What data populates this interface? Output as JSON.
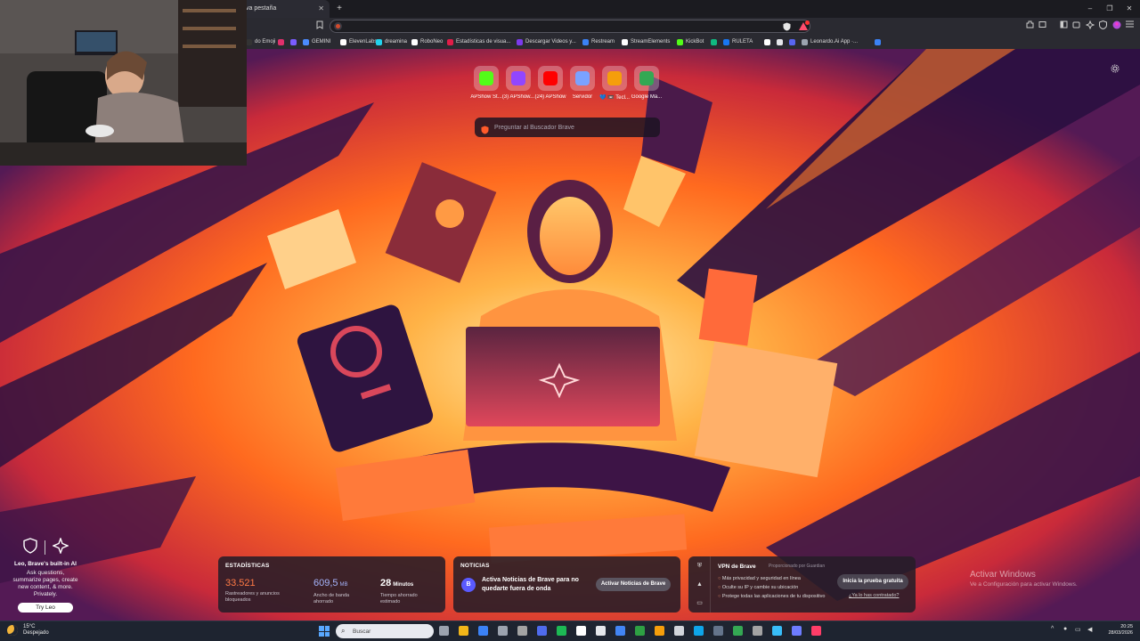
{
  "tab": {
    "title": "va pestaña",
    "close": "✕",
    "new": "+"
  },
  "window": {
    "minimize": "–",
    "maximize": "❐",
    "close": "✕"
  },
  "address": {
    "value": "",
    "placeholder": ""
  },
  "bookmarks": [
    {
      "label": "do Emoji",
      "color": "#333"
    },
    {
      "label": "",
      "color": "#e1306c"
    },
    {
      "label": "",
      "color": "#7b5cff"
    },
    {
      "label": "GEMINI",
      "color": "#4b8bff"
    },
    {
      "label": "ElevenLabs",
      "color": "#ffffff"
    },
    {
      "label": "dreamina",
      "color": "#22d3ee"
    },
    {
      "label": "RoboNeo",
      "color": "#ffffff"
    },
    {
      "label": "Estadísticas de visua...",
      "color": "#e11d48"
    },
    {
      "label": "Descargar Videos y...",
      "color": "#7c3aed"
    },
    {
      "label": "Restream",
      "color": "#3b82f6"
    },
    {
      "label": "StreamElements",
      "color": "#ffffff"
    },
    {
      "label": "KickBot",
      "color": "#53fc18"
    },
    {
      "label": "",
      "color": "#10b981"
    },
    {
      "label": "RULETA",
      "color": "#1877f2"
    },
    {
      "label": "",
      "color": "#ffffff"
    },
    {
      "label": "",
      "color": "#e5e7eb"
    },
    {
      "label": "",
      "color": "#5865f2"
    },
    {
      "label": "Leonardo.Ai App ·...",
      "color": "#9ca3af"
    },
    {
      "label": "",
      "color": "#3b82f6"
    }
  ],
  "top_sites": [
    {
      "label": "APShow St...",
      "icon": "kick-icon",
      "color": "#53fc18"
    },
    {
      "label": "(3) APShow...",
      "icon": "twitch-icon",
      "color": "#9146ff"
    },
    {
      "label": "(24) APShow",
      "icon": "youtube-icon",
      "color": "#ff0000"
    },
    {
      "label": "Servidor",
      "icon": "server-icon",
      "color": "#7aa2ff"
    },
    {
      "label": "💙 📼 Tecl...",
      "icon": "avatar-icon",
      "color": "#f59e0b"
    },
    {
      "label": "Google Ma...",
      "icon": "maps-icon",
      "color": "#34a853"
    }
  ],
  "search": {
    "placeholder": "Preguntar al Buscador Brave"
  },
  "leo": {
    "title": "Leo, Brave's built-in AI",
    "lines": [
      "Ask questions,",
      "summarize pages, create",
      "new content, & more.",
      "Privately."
    ],
    "button": "Try Leo"
  },
  "stats": {
    "header": "ESTADÍSTICAS",
    "items": [
      {
        "value": "33.521",
        "unit": "",
        "caption1": "Rastreadores y anuncios",
        "caption2": "bloqueados",
        "color": "#ff7a45"
      },
      {
        "value": "609,5",
        "unit": "MB",
        "caption1": "Ancho de banda",
        "caption2": "ahorrado",
        "color": "#a5b4fc"
      },
      {
        "value": "28",
        "unit": "Minutos",
        "caption1": "Tiempo ahorrado",
        "caption2": "estimado",
        "color": "#ffffff"
      }
    ]
  },
  "news": {
    "header": "NOTICIAS",
    "line1": "Activa Noticias de Brave para no",
    "line2": "quedarte fuera de onda",
    "button": "Activar Noticias de Brave"
  },
  "vpn": {
    "title": "VPN de Brave",
    "powered": "Proporcionado por  Guardian",
    "features": [
      "Más privacidad y seguridad en línea",
      "Oculte su IP y cambie su ubicación",
      "Protege todas las aplicaciones de tu dispositivo"
    ],
    "button": "Inicia la prueba gratuita",
    "link": "¿Ya lo has contratado?"
  },
  "activate_windows": {
    "title": "Activar Windows",
    "subtitle": "Ve a Configuración para activar Windows."
  },
  "taskbar": {
    "weather_temp": "15°C",
    "weather_desc": "Despejado",
    "search_placeholder": "Buscar",
    "time": "20:25",
    "date": "28/03/2026",
    "apps": [
      "#9ca3af",
      "#f2b619",
      "#3b82f6",
      "#9ca3af",
      "#a3a3a3",
      "#4f6bed",
      "#1db954",
      "#ffffff",
      "#e5e7eb",
      "#4285f4",
      "#2ea043",
      "#f59e0b",
      "#d1d5db",
      "#0ea5e9",
      "#64748b",
      "#34a853",
      "#a3a3a3",
      "#38bdf8",
      "#6d7cff",
      "#ff3d68"
    ]
  },
  "colors": {
    "accent": "#ff5a2a",
    "chrome": "#2a2a31",
    "taskbar": "#1e2430"
  }
}
